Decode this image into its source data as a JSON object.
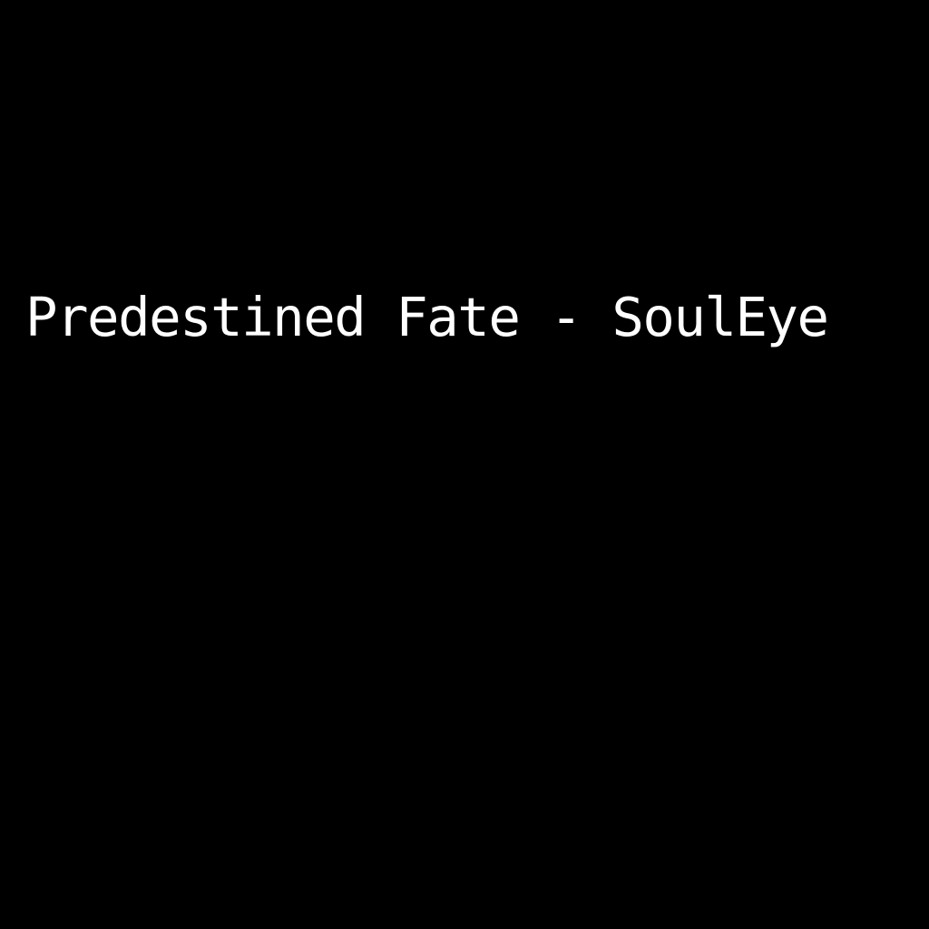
{
  "screen": {
    "title": "Predestined Fate - SoulEye",
    "background_color": "#000000",
    "text_color": "#ffffff"
  }
}
